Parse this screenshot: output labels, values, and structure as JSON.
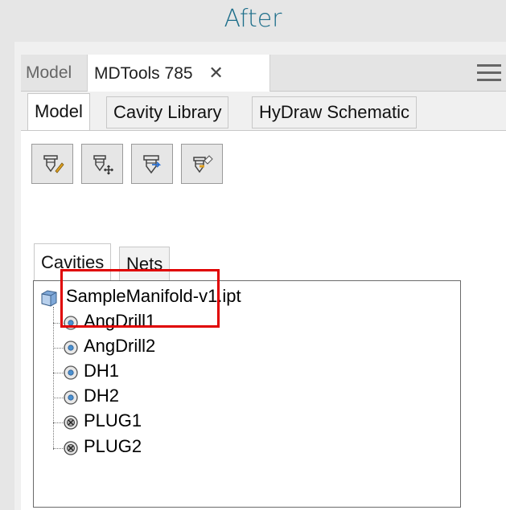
{
  "caption": "After",
  "doc_tabs": {
    "inactive_label": "Model",
    "active_label": "MDTools 785",
    "close_glyph": "✕"
  },
  "sub_tabs": [
    {
      "label": "Model",
      "active": true
    },
    {
      "label": "Cavity Library",
      "active": false
    },
    {
      "label": "HyDraw Schematic",
      "active": false
    }
  ],
  "toolbar": {
    "buttons": [
      {
        "icon": "edit-cavity-icon"
      },
      {
        "icon": "add-cavity-icon"
      },
      {
        "icon": "cavity-properties-icon"
      },
      {
        "icon": "cavity-export-icon"
      }
    ]
  },
  "inner_tabs": [
    {
      "label": "Cavities",
      "active": true
    },
    {
      "label": "Nets",
      "active": false
    }
  ],
  "tree": {
    "root": {
      "label": "SampleManifold-v1.ipt",
      "icon": "part-file-icon"
    },
    "items": [
      {
        "label": "AngDrill1",
        "icon": "drill-cavity-icon"
      },
      {
        "label": "AngDrill2",
        "icon": "drill-cavity-icon"
      },
      {
        "label": "DH1",
        "icon": "drill-cavity-icon"
      },
      {
        "label": "DH2",
        "icon": "drill-cavity-icon"
      },
      {
        "label": "PLUG1",
        "icon": "plug-cavity-icon"
      },
      {
        "label": "PLUG2",
        "icon": "plug-cavity-icon"
      }
    ]
  },
  "colors": {
    "caption": "#1f6f8b",
    "highlight": "#e00000"
  }
}
